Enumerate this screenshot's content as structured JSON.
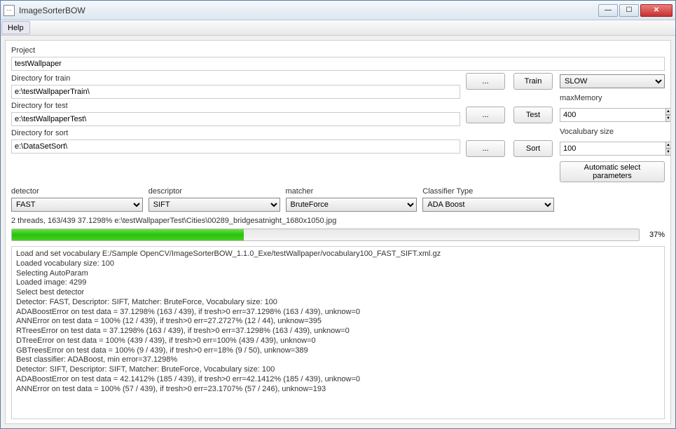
{
  "window": {
    "title": "ImageSorterBOW"
  },
  "menu": {
    "help": "Help"
  },
  "labels": {
    "project": "Project",
    "dir_train": "Directory for train",
    "dir_test": "Directory for test",
    "dir_sort": "Directory for sort",
    "detector": "detector",
    "descriptor": "descriptor",
    "matcher": "matcher",
    "classifier": "Classifier Type",
    "maxMemory": "maxMemory",
    "vocabSize": "Vocalubary size"
  },
  "fields": {
    "project": "testWallpaper",
    "dir_train": "e:\\testWallpaperTrain\\",
    "dir_test": "e:\\testWallpaperTest\\",
    "dir_sort": "e:\\DataSetSort\\",
    "maxMemory": "400",
    "vocabSize": "100"
  },
  "buttons": {
    "browse": "...",
    "train": "Train",
    "test": "Test",
    "sort": "Sort",
    "autoparam": "Automatic select parameters"
  },
  "combos": {
    "speed": "SLOW",
    "detector": "FAST",
    "descriptor": "SIFT",
    "matcher": "BruteForce",
    "classifier": "ADA Boost"
  },
  "status": "2 threads, 163/439 37.1298% e:\\testWallpaperTest\\Cities\\00289_bridgesatnight_1680x1050.jpg",
  "progress": {
    "pct_text": "37%",
    "pct_value": 37
  },
  "log": "Load and set vocabulary E:/Sample OpenCV/ImageSorterBOW_1.1.0_Exe/testWallpaper/vocabulary100_FAST_SIFT.xml.gz\nLoaded vocabulary size: 100\nSelecting AutoParam\nLoaded image: 4299\nSelect best detector\nDetector: FAST, Descriptor: SIFT, Matcher: BruteForce, Vocabulary size: 100\nADABoostError on test data = 37.1298% (163 / 439), if tresh>0 err=37.1298% (163 / 439), unknow=0\nANNError on test data = 100% (12 / 439), if tresh>0 err=27.2727% (12 / 44), unknow=395\nRTreesError on test data = 37.1298% (163 / 439), if tresh>0 err=37.1298% (163 / 439), unknow=0\nDTreeError on test data = 100% (439 / 439), if tresh>0 err=100% (439 / 439), unknow=0\nGBTreesError on test data = 100% (9 / 439), if tresh>0 err=18% (9 / 50), unknow=389\nBest classifier: ADABoost, min error=37.1298%\nDetector: SIFT, Descriptor: SIFT, Matcher: BruteForce, Vocabulary size: 100\nADABoostError on test data = 42.1412% (185 / 439), if tresh>0 err=42.1412% (185 / 439), unknow=0\nANNError on test data = 100% (57 / 439), if tresh>0 err=23.1707% (57 / 246), unknow=193"
}
